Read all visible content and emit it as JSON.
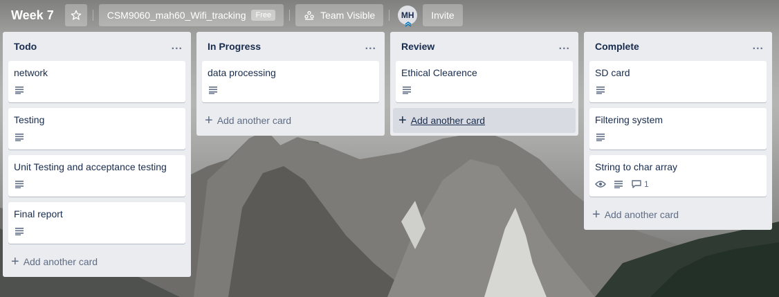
{
  "board": {
    "title": "Week 7",
    "name": "CSM9060_mah60_Wifi_tracking",
    "plan_badge": "Free",
    "visibility": "Team Visible",
    "member_initials": "MH",
    "invite_label": "Invite"
  },
  "list_menu_label": "...",
  "add_card_label": "Add another card",
  "lists": [
    {
      "title": "Todo",
      "cards": [
        {
          "title": "network"
        },
        {
          "title": "Testing"
        },
        {
          "title": "Unit Testing and acceptance testing"
        },
        {
          "title": "Final report"
        }
      ]
    },
    {
      "title": "In Progress",
      "cards": [
        {
          "title": "data processing"
        }
      ]
    },
    {
      "title": "Review",
      "cards": [
        {
          "title": "Ethical Clearence"
        }
      ]
    },
    {
      "title": "Complete",
      "cards": [
        {
          "title": "SD card"
        },
        {
          "title": "Filtering system"
        },
        {
          "title": "String to char array",
          "comment_count": "1"
        }
      ]
    }
  ],
  "icons": {
    "star": "star-icon",
    "visibility": "team-icon",
    "description": "description-icon",
    "watch": "eye-icon",
    "comment": "comment-icon",
    "add": "plus-icon"
  }
}
